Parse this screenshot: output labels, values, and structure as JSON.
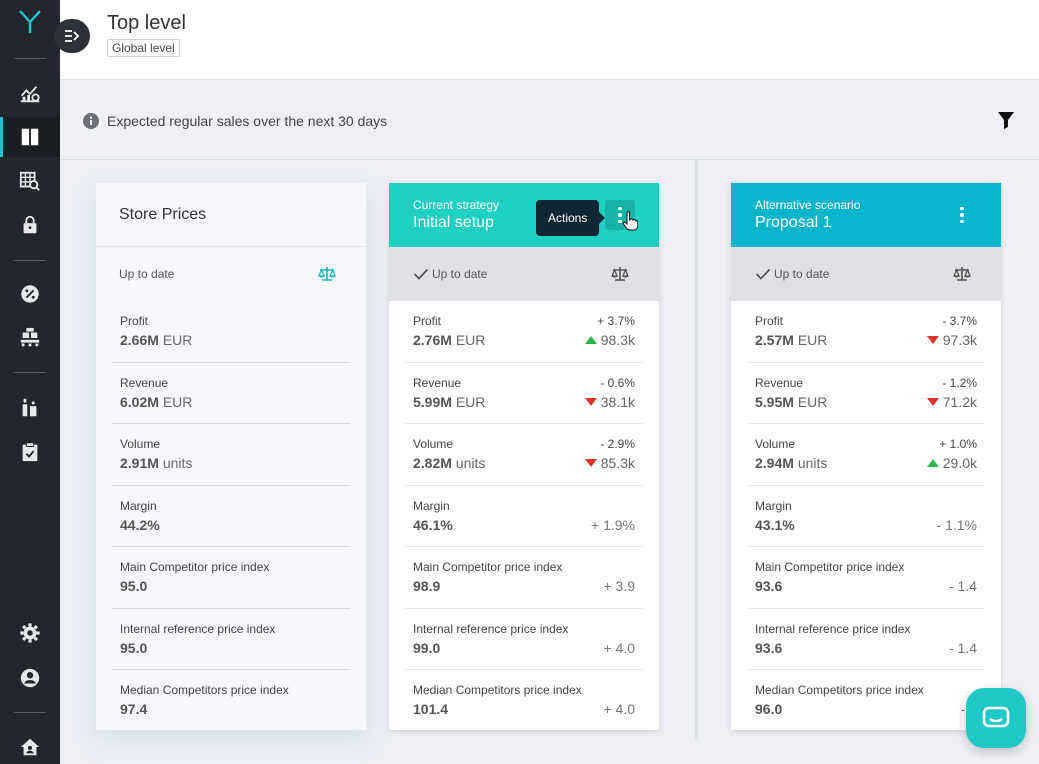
{
  "header": {
    "title": "Top level",
    "level_badge": "Global level"
  },
  "info_bar": {
    "text": "Expected regular sales over the next 30 days"
  },
  "sidebar": {
    "items": [
      {
        "icon": "analytics-icon"
      },
      {
        "icon": "columns-icon",
        "active": true
      },
      {
        "icon": "table-search-icon"
      },
      {
        "icon": "lock-icon"
      },
      {
        "icon": "badge-percent-icon"
      },
      {
        "icon": "pallet-icon"
      },
      {
        "icon": "bottles-icon"
      },
      {
        "icon": "clipboard-check-icon"
      },
      {
        "icon": "gear-icon"
      },
      {
        "icon": "user-icon"
      },
      {
        "icon": "home-icon"
      }
    ]
  },
  "base_card": {
    "title": "Store Prices",
    "status": "Up to date",
    "metrics": [
      {
        "label": "Profit",
        "value": "2.66M",
        "unit": "EUR"
      },
      {
        "label": "Revenue",
        "value": "6.02M",
        "unit": "EUR"
      },
      {
        "label": "Volume",
        "value": "2.91M",
        "unit": "units"
      },
      {
        "label": "Margin",
        "value": "44.2%",
        "unit": ""
      },
      {
        "label": "Main Competitor price index",
        "value": "95.0",
        "unit": ""
      },
      {
        "label": "Internal reference price index",
        "value": "95.0",
        "unit": ""
      },
      {
        "label": "Median Competitors price index",
        "value": "97.4",
        "unit": ""
      }
    ]
  },
  "current_card": {
    "subtitle": "Current strategy",
    "title": "Initial setup",
    "tooltip": "Actions",
    "status": "Up to date",
    "color": "#1fd0c1",
    "metrics": [
      {
        "label": "Profit",
        "value": "2.76M",
        "unit": "EUR",
        "pct": "+ 3.7%",
        "delta": "98.3k",
        "dir": "up"
      },
      {
        "label": "Revenue",
        "value": "5.99M",
        "unit": "EUR",
        "pct": "- 0.6%",
        "delta": "38.1k",
        "dir": "down"
      },
      {
        "label": "Volume",
        "value": "2.82M",
        "unit": "units",
        "pct": "- 2.9%",
        "delta": "85.3k",
        "dir": "down"
      },
      {
        "label": "Margin",
        "value": "46.1%",
        "unit": "",
        "change": "+ 1.9%"
      },
      {
        "label": "Main Competitor price index",
        "value": "98.9",
        "unit": "",
        "change": "+ 3.9"
      },
      {
        "label": "Internal reference price index",
        "value": "99.0",
        "unit": "",
        "change": "+ 4.0"
      },
      {
        "label": "Median Competitors price index",
        "value": "101.4",
        "unit": "",
        "change": "+ 4.0"
      }
    ]
  },
  "alt_card": {
    "subtitle": "Alternative scenario",
    "title": "Proposal 1",
    "status": "Up to date",
    "color": "#0bb5cc",
    "metrics": [
      {
        "label": "Profit",
        "value": "2.57M",
        "unit": "EUR",
        "pct": "- 3.7%",
        "delta": "97.3k",
        "dir": "down"
      },
      {
        "label": "Revenue",
        "value": "5.95M",
        "unit": "EUR",
        "pct": "- 1.2%",
        "delta": "71.2k",
        "dir": "down"
      },
      {
        "label": "Volume",
        "value": "2.94M",
        "unit": "units",
        "pct": "+ 1.0%",
        "delta": "29.0k",
        "dir": "up"
      },
      {
        "label": "Margin",
        "value": "43.1%",
        "unit": "",
        "change": "- 1.1%"
      },
      {
        "label": "Main Competitor price index",
        "value": "93.6",
        "unit": "",
        "change": "- 1.4"
      },
      {
        "label": "Internal reference price index",
        "value": "93.6",
        "unit": "",
        "change": "- 1.4"
      },
      {
        "label": "Median Competitors price index",
        "value": "96.0",
        "unit": "",
        "change": "- 1"
      }
    ]
  }
}
